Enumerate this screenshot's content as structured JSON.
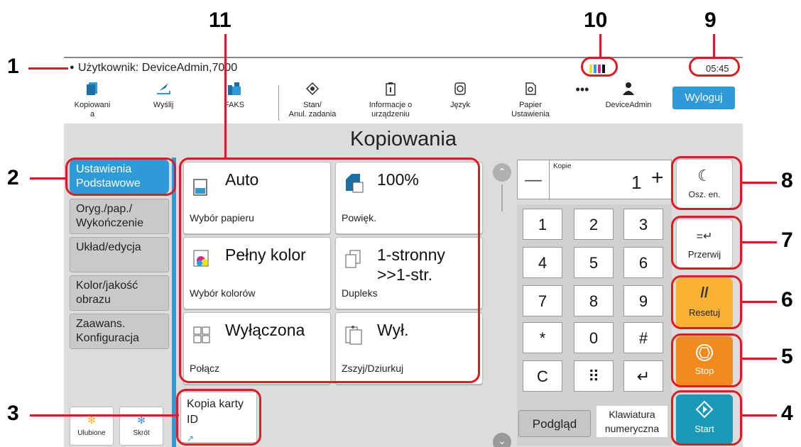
{
  "callouts": [
    "1",
    "2",
    "3",
    "4",
    "5",
    "6",
    "7",
    "8",
    "9",
    "10",
    "11"
  ],
  "statusbar": {
    "user_label": "Użytkownik: DeviceAdmin,7000",
    "time": "05:45"
  },
  "toolbar": {
    "items": [
      {
        "label": "Kopiowani\na",
        "icon": "copy-icon"
      },
      {
        "label": "Wyślij",
        "icon": "send-icon"
      },
      {
        "label": "FAKS",
        "icon": "fax-icon"
      },
      {
        "label": "Stan/\nAnul. zadania",
        "icon": "job-status-icon"
      },
      {
        "label": "Informacje o\nurządzeniu",
        "icon": "device-info-icon"
      },
      {
        "label": "Język",
        "icon": "language-icon"
      },
      {
        "label": "Papier\nUstawienia",
        "icon": "paper-settings-icon"
      }
    ],
    "more": "•••",
    "account_label": "DeviceAdmin",
    "logout_label": "Wyloguj"
  },
  "screen_title": "Kopiowania",
  "nav": [
    "Ustawienia Podstawowe",
    "Oryg./pap./ Wykończenie",
    "Układ/edycja",
    "Kolor/jakość obrazu",
    "Zaawans. Konfiguracja"
  ],
  "cards": [
    {
      "value": "Auto",
      "label": "Wybór papieru",
      "icon": "paper-select-icon"
    },
    {
      "value": "100%",
      "label": "Powięk.",
      "icon": "zoom-icon"
    },
    {
      "value": "Pełny kolor",
      "label": "Wybór kolorów",
      "icon": "color-select-icon"
    },
    {
      "value": "1-stronny >>1-str.",
      "label": "Dupleks",
      "icon": "duplex-icon"
    },
    {
      "value": "Wyłączona",
      "label": "Połącz",
      "icon": "combine-icon"
    },
    {
      "value": "Wył.",
      "label": "Zszyj/Dziurkuj",
      "icon": "staple-punch-icon"
    }
  ],
  "id_card": {
    "label": "Kopia karty ID"
  },
  "shortcuts": {
    "favorites": "Ulubione",
    "shortcut": "Skrót"
  },
  "copies": {
    "label": "Kopie",
    "value": "1",
    "minus": "—",
    "plus": "+"
  },
  "keypad": [
    "1",
    "2",
    "3",
    "4",
    "5",
    "6",
    "7",
    "8",
    "9",
    "*",
    "0",
    "#",
    "C",
    "⠿",
    "↵"
  ],
  "preview_label": "Podgląd",
  "numeric_keyboard_label": "Klawiatura numeryczna",
  "side_buttons": {
    "energy_saver": "Osz. en.",
    "interrupt": "Przerwij",
    "reset": "Resetuj",
    "stop": "Stop",
    "start": "Start"
  },
  "colors": {
    "accent": "#2e9ad8",
    "callout_red": "#e01a22",
    "reset_orange": "#f9b233",
    "stop_orange": "#f28a1d",
    "start_teal": "#1a9ab8"
  }
}
